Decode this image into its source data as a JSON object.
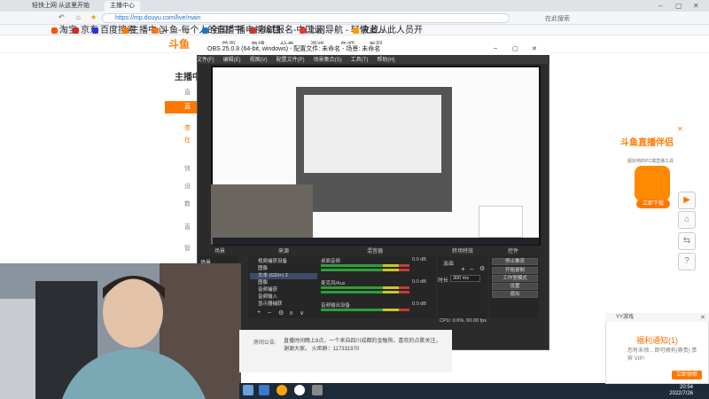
{
  "browser": {
    "tabs": [
      {
        "label": "轻快上网 从这里开始"
      },
      {
        "label": "主播中心",
        "active": true
      }
    ],
    "url": "https://mp.douyu.com/live/main",
    "search_label": "在此搜索",
    "bookmarks": [
      "淘宝",
      "京东",
      "百度搜索",
      "主播中心",
      "斗鱼-每个人的直播平",
      "全国广播电视编目",
      "考试报名-中国证...",
      "上网导航 - 轻快上...",
      "收藏从此人员开"
    ]
  },
  "douyu": {
    "logo": "斗鱼",
    "nav": [
      "首页",
      "直播",
      "分类",
      "游戏",
      "鱼吧",
      "发现"
    ],
    "side_title": "主播中",
    "side_items": [
      "直",
      "直",
      "查",
      "在",
      "快",
      "设",
      "数",
      "直",
      "管"
    ],
    "ad": {
      "title": "斗鱼直播伴侣",
      "subtitle": "超好用的PC端直播工具",
      "button": "立即下载"
    },
    "announcement_label": "房间公告:",
    "announcement_text": "直播时间晚上8点，一个来自四川成都的金融狗，喜欢的点歌关注，谢谢大家。 火炬群：117331970"
  },
  "obs": {
    "title": "OBS 25.0.8 (64-bit, windows) - 配置文件: 未命名 - 场景: 未命名",
    "menu": [
      "文件(F)",
      "编辑(E)",
      "视图(V)",
      "配置文件(P)",
      "场景集合(S)",
      "工具(T)",
      "帮助(H)"
    ],
    "panels": [
      "场景",
      "来源",
      "混音器",
      "转场特效",
      "控件"
    ],
    "scene": "场景",
    "sources": [
      "视频捕获设备",
      "图像",
      "文本 (GDI+) 2",
      "图像",
      "音频捕获",
      "音频输入",
      "显示器捕获"
    ],
    "mixer": [
      {
        "name": "桌面音频",
        "level": "0.0 dB"
      },
      {
        "name": "麦克风/Aux",
        "level": "0.0 dB"
      },
      {
        "name": "音频输出设备",
        "level": "0.0 dB"
      }
    ],
    "transition": {
      "name": "淡出",
      "duration_label": "时长",
      "duration": "300 ms"
    },
    "controls": [
      "停止推流",
      "开始录制",
      "工作室模式",
      "设置",
      "退出"
    ],
    "status": "CPU: 0.6%, 60.00 fps"
  },
  "notification": {
    "header": "YY游戏",
    "title": "福利通知(1)",
    "body": "您有未领... 即可拥有(尊贵) 贵宾 VIP!",
    "button": "立即领取"
  },
  "clock": {
    "time": "20:54",
    "date": "2022/7/26"
  },
  "colors": {
    "douyu_orange": "#ff7700",
    "obs_bg": "#2b2b2b",
    "taskbar": "#1d2a3a"
  }
}
